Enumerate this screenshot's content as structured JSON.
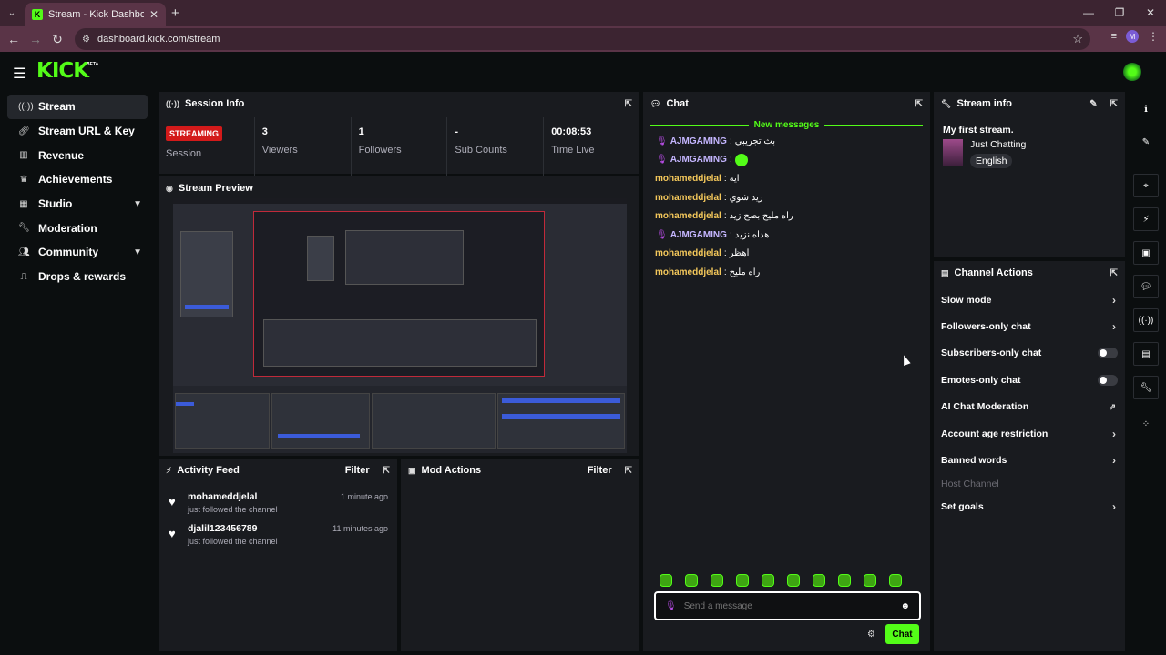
{
  "browser": {
    "tab_title": "Stream - Kick Dashboard",
    "url": "dashboard.kick.com/stream",
    "profile_initial": "M"
  },
  "app": {
    "logo": "KICK",
    "beta": "BETA"
  },
  "sidebar": {
    "items": [
      {
        "label": "Stream",
        "icon": "broadcast-icon"
      },
      {
        "label": "Stream URL & Key",
        "icon": "link-icon"
      },
      {
        "label": "Revenue",
        "icon": "chart-icon"
      },
      {
        "label": "Achievements",
        "icon": "trophy-icon"
      },
      {
        "label": "Studio",
        "icon": "studio-icon"
      },
      {
        "label": "Moderation",
        "icon": "wrench-icon"
      },
      {
        "label": "Community",
        "icon": "users-icon"
      },
      {
        "label": "Drops & rewards",
        "icon": "gift-icon"
      }
    ]
  },
  "session": {
    "title": "Session Info",
    "status": "STREAMING",
    "status_label": "Session",
    "viewers": "3",
    "viewers_label": "Viewers",
    "followers": "1",
    "followers_label": "Followers",
    "subs": "-",
    "subs_label": "Sub Counts",
    "time": "00:08:53",
    "time_label": "Time Live"
  },
  "preview": {
    "title": "Stream Preview"
  },
  "activity": {
    "title": "Activity Feed",
    "filter": "Filter",
    "items": [
      {
        "name": "mohameddjelal",
        "desc": "just followed the channel",
        "time": "1 minute ago"
      },
      {
        "name": "djalil123456789",
        "desc": "just followed the channel",
        "time": "11 minutes ago"
      }
    ]
  },
  "mod": {
    "title": "Mod Actions",
    "filter": "Filter"
  },
  "chat": {
    "title": "Chat",
    "new_messages": "New messages",
    "messages": [
      {
        "user": "AJMGAMING",
        "text": "بث تجريبي",
        "badge": true,
        "color": "purple"
      },
      {
        "user": "AJMGAMING",
        "text": "",
        "badge": true,
        "color": "purple",
        "emote": true
      },
      {
        "user": "mohameddjelal",
        "text": "ايه",
        "badge": false,
        "color": "yellow"
      },
      {
        "user": "mohameddjelal",
        "text": "زيد شوي",
        "badge": false,
        "color": "yellow"
      },
      {
        "user": "mohameddjelal",
        "text": "راه مليح بصح زيد",
        "badge": false,
        "color": "yellow"
      },
      {
        "user": "AJMGAMING",
        "text": "هداه نزيد",
        "badge": true,
        "color": "purple"
      },
      {
        "user": "mohameddjelal",
        "text": "اهظر",
        "badge": false,
        "color": "yellow"
      },
      {
        "user": "mohameddjelal",
        "text": "راه مليح",
        "badge": false,
        "color": "yellow"
      }
    ],
    "placeholder": "Send a message",
    "send": "Chat"
  },
  "stream_info": {
    "title": "Stream info",
    "stream_title": "My first stream.",
    "category": "Just Chatting",
    "language": "English"
  },
  "channel_actions": {
    "title": "Channel Actions",
    "items": [
      {
        "label": "Slow mode",
        "control": "chevron"
      },
      {
        "label": "Followers-only chat",
        "control": "chevron"
      },
      {
        "label": "Subscribers-only chat",
        "control": "toggle"
      },
      {
        "label": "Emotes-only chat",
        "control": "toggle"
      },
      {
        "label": "AI Chat Moderation",
        "control": "external"
      },
      {
        "label": "Account age restriction",
        "control": "chevron"
      },
      {
        "label": "Banned words",
        "control": "chevron"
      },
      {
        "label": "Host Channel",
        "control": "none"
      },
      {
        "label": "Set goals",
        "control": "chevron"
      }
    ]
  },
  "colors": {
    "brand": "#53fc18",
    "live": "#d31a1a",
    "panel": "#191b1f"
  }
}
